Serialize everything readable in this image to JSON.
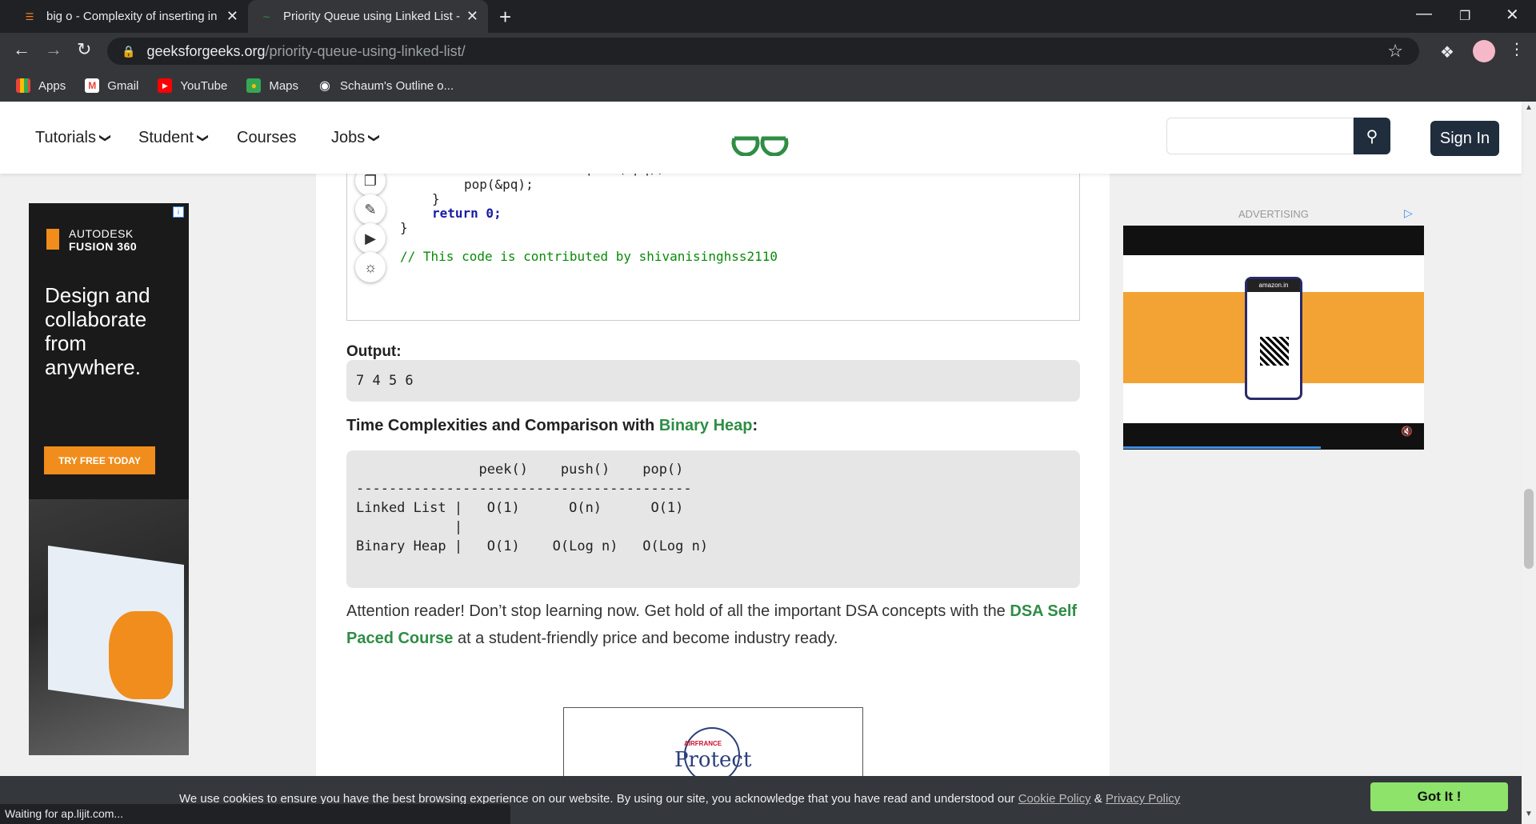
{
  "browser": {
    "tabs": [
      {
        "title": "big o - Complexity of inserting in",
        "icon": "stackoverflow-icon"
      },
      {
        "title": "Priority Queue using Linked List -",
        "icon": "gfg-favicon"
      }
    ],
    "new_tab": "+",
    "address": {
      "domain": "geeksforgeeks.org",
      "path": "/priority-queue-using-linked-list/"
    },
    "bookmarks": [
      {
        "label": "Apps",
        "icon": "apps-grid-icon"
      },
      {
        "label": "Gmail",
        "icon": "gmail-icon"
      },
      {
        "label": "YouTube",
        "icon": "youtube-icon"
      },
      {
        "label": "Maps",
        "icon": "maps-icon"
      },
      {
        "label": "Schaum's Outline o...",
        "icon": "globe-icon"
      }
    ]
  },
  "site_header": {
    "nav": [
      "Tutorials",
      "Student",
      "Courses",
      "Jobs"
    ],
    "sign_in": "Sign In",
    "search_placeholder": ""
  },
  "code": {
    "lines": [
      "cout <<      << peek(&pq);",
      "pop(&pq);",
      "}",
      "return 0;",
      "}",
      "// This code is contributed by shivanisinghss2110"
    ]
  },
  "output": {
    "label": "Output:",
    "value": "7 4 5 6"
  },
  "time_complexities": {
    "heading_prefix": "Time Complexities and Comparison with ",
    "heading_link": "Binary Heap",
    "heading_suffix": ":",
    "lines": [
      "               peek()    push()    pop()",
      "-----------------------------------------",
      "Linked List |   O(1)      O(n)      O(1)",
      "            |",
      "Binary Heap |   O(1)    O(Log n)   O(Log n)"
    ]
  },
  "attention": {
    "text1": "Attention reader! Don’t stop learning now. Get hold of all the important DSA concepts with the ",
    "link": "DSA Self Paced Course",
    "text2": " at a student-friendly price and become industry ready."
  },
  "ad_left": {
    "brand_line1": "AUTODESK",
    "brand_line2": "FUSION 360",
    "headline": "Design and collaborate from anywhere.",
    "cta": "TRY FREE TODAY"
  },
  "ad_right": {
    "label": "ADVERTISING",
    "phone_brand": "amazon.in"
  },
  "ad_bottom": {
    "brand_small": "AIRFRANCE",
    "brand": "Protect"
  },
  "cookie": {
    "text": "We use cookies to ensure you have the best browsing experience on our website. By using our site, you acknowledge that you have read and understood our ",
    "cookie_policy": "Cookie Policy",
    "amp": " & ",
    "privacy_policy": "Privacy Policy",
    "button": "Got It !"
  },
  "status_text": "Waiting for ap.lijit.com...",
  "colors": {
    "gfg_green": "#2f8d46",
    "header_dark": "#1f2d3d",
    "cookie_button": "#8ee36b"
  }
}
